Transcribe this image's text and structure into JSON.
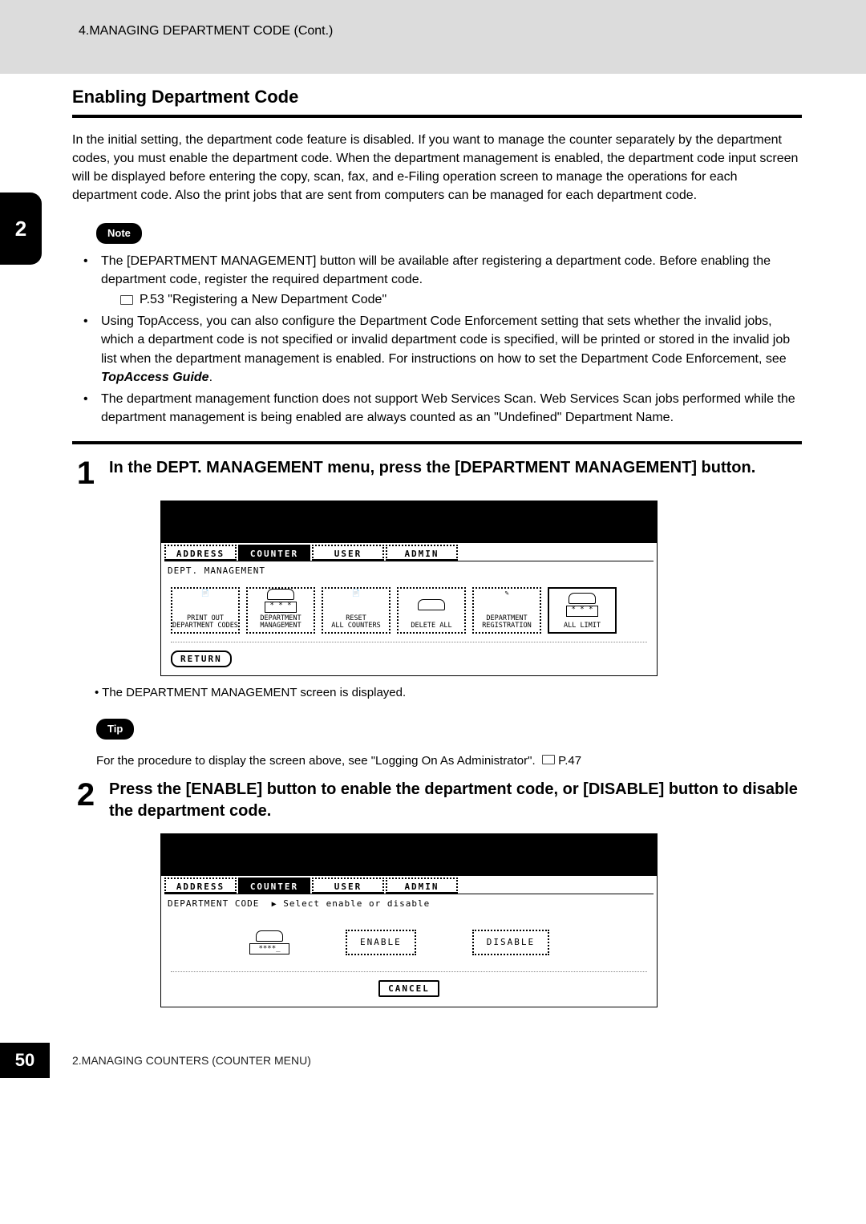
{
  "header": {
    "breadcrumb": "4.MANAGING DEPARTMENT CODE (Cont.)"
  },
  "side_tab": "2",
  "section": {
    "title": "Enabling Department Code"
  },
  "intro": "In the initial setting, the department code feature is disabled.  If you want to manage the counter separately by the department codes, you must enable the department code.  When the department management is enabled, the department code input screen will be displayed before entering the copy, scan, fax, and e-Filing operation screen to manage the operations for each department code.  Also the print jobs that are sent from computers can be managed for each department code.",
  "note_label": "Note",
  "notes": {
    "n1a": "The [DEPARTMENT MANAGEMENT] button will be available after registering a department code. Before enabling the department code, register the required department code.",
    "n1ref": "P.53 \"Registering a New Department Code\"",
    "n2a": "Using TopAccess, you can also configure the Department Code Enforcement setting that sets whether the invalid jobs, which a department code is not specified or invalid department code is specified, will be printed or stored in the invalid job list when the department management is enabled. For instructions on how to set the Department Code Enforcement, see ",
    "n2b": "TopAccess Guide",
    "n2c": ".",
    "n3": "The department management function does not support Web Services Scan. Web Services Scan jobs performed while the department management is being enabled are always counted as an \"Undefined\" Department Name."
  },
  "steps": {
    "s1_num": "1",
    "s1_text": "In the DEPT. MANAGEMENT menu, press the [DEPARTMENT MANAGEMENT] button.",
    "s1_result": "The DEPARTMENT MANAGEMENT screen is displayed.",
    "s2_num": "2",
    "s2_text": "Press the [ENABLE] button to enable the department code, or [DISABLE] button to disable the department code."
  },
  "tip_label": "Tip",
  "tip_text": "For the procedure to display the screen above, see \"Logging On As Administrator\".",
  "tip_ref": "P.47",
  "panel1": {
    "tabs": [
      "ADDRESS",
      "COUNTER",
      "USER",
      "ADMIN"
    ],
    "active_tab": 1,
    "crumb": "DEPT. MANAGEMENT",
    "buttons": [
      "PRINT OUT\nDEPARTMENT CODES",
      "DEPARTMENT\nMANAGEMENT",
      "RESET\nALL COUNTERS",
      "DELETE ALL",
      "DEPARTMENT\nREGISTRATION",
      "ALL LIMIT"
    ],
    "key_glyph": "* * *",
    "footer_btn": "RETURN"
  },
  "panel2": {
    "tabs": [
      "ADDRESS",
      "COUNTER",
      "USER",
      "ADMIN"
    ],
    "active_tab": 1,
    "crumb_a": "DEPARTMENT CODE",
    "crumb_arrow": "▶",
    "crumb_b": "Select enable or disable",
    "key_glyph": "****_",
    "btn_enable": "ENABLE",
    "btn_disable": "DISABLE",
    "footer_btn": "CANCEL"
  },
  "footer": {
    "page": "50",
    "text": "2.MANAGING COUNTERS (COUNTER MENU)"
  }
}
